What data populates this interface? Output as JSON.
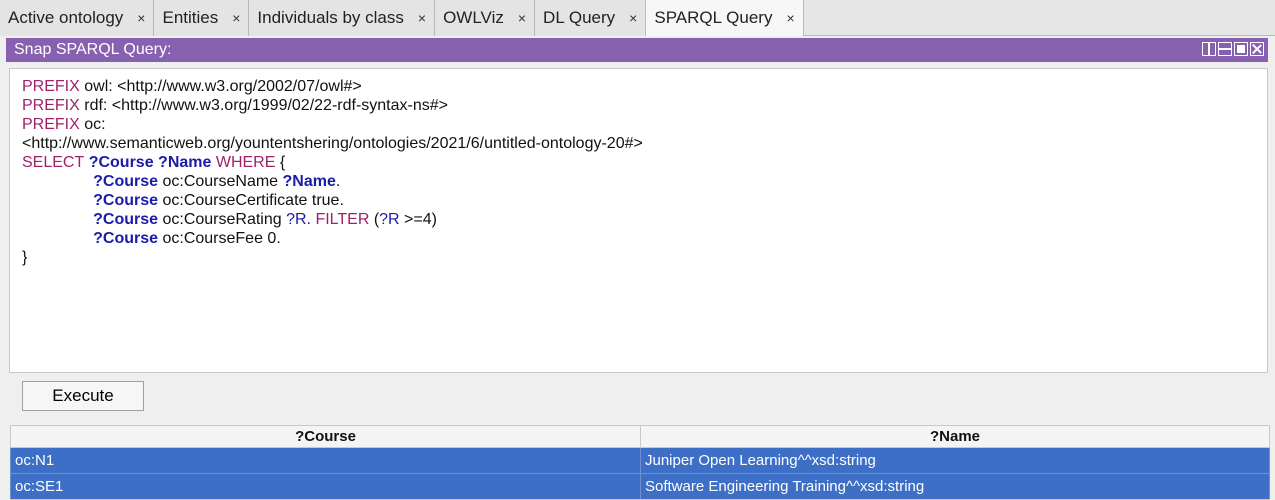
{
  "tabs": [
    {
      "label": "Active ontology",
      "close": "×"
    },
    {
      "label": "Entities",
      "close": "×"
    },
    {
      "label": "Individuals by class",
      "close": "×"
    },
    {
      "label": "OWLViz",
      "close": "×"
    },
    {
      "label": "DL Query",
      "close": "×"
    },
    {
      "label": "SPARQL Query",
      "close": "×"
    }
  ],
  "panel": {
    "title": "Snap SPARQL Query:"
  },
  "query": {
    "prefix_owl_kw": "PREFIX",
    "prefix_owl_rest": " owl: <http://www.w3.org/2002/07/owl#>",
    "prefix_rdf_kw": "PREFIX",
    "prefix_rdf_rest": " rdf: <http://www.w3.org/1999/02/22-rdf-syntax-ns#>",
    "prefix_oc_kw": "PREFIX",
    "prefix_oc_rest": " oc:",
    "prefix_oc_iri": "<http://www.semanticweb.org/yountentshering/ontologies/2021/6/untitled-ontology-20#>",
    "select_kw": "SELECT",
    "select_vars": " ?Course ?Name",
    "where_kw": " WHERE",
    "open_brace": " {",
    "t1_var": "?Course",
    "t1_rest": " oc:CourseName ",
    "t1_obj": "?Name",
    "t1_end": ".",
    "t2_var": "?Course",
    "t2_rest": " oc:CourseCertificate true.",
    "t3_var": "?Course",
    "t3_rest": " oc:CourseRating ",
    "t3_obj": "?R.",
    "t3_filter": " FILTER ",
    "t3_open": "(",
    "t3_fvar": "?R",
    "t3_cond": " >=4)",
    "t4_var": "?Course",
    "t4_rest": " oc:CourseFee 0.",
    "close_brace": "}"
  },
  "execute_label": "Execute",
  "results": {
    "headers": [
      "?Course",
      "?Name"
    ],
    "rows": [
      [
        "oc:N1",
        "Juniper Open Learning^^xsd:string"
      ],
      [
        "oc:SE1",
        "Software Engineering Training^^xsd:string"
      ]
    ]
  }
}
